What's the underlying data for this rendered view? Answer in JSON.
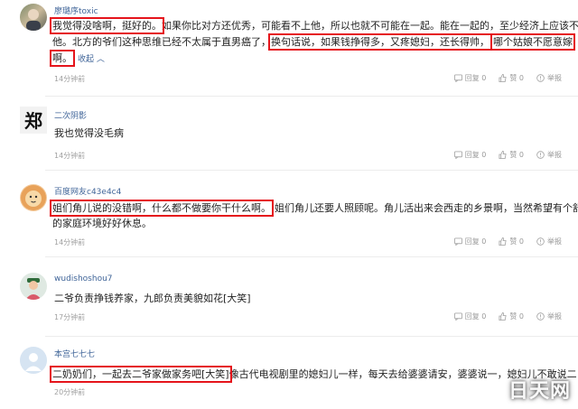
{
  "comments": [
    {
      "username": "廖璐序toxic",
      "avatar": "photo-avatar",
      "text_lines": [
        [
          "我觉得没啥啊，挺好的。",
          "如果你比对方还优秀，可能看不上他，所以也就不可能在一起。能在一起的，至少经济上应该不如"
        ],
        [
          "他。北方的爷们这种思维已经不太属于直男癌了，",
          "换句话说，如果钱挣得多，又疼媳妇，还长得帅，",
          "哪个姑娘不愿意嫁"
        ],
        [
          "啊。",
          "收起"
        ]
      ],
      "time": "14分钟前",
      "reply_label": "回复 0",
      "like_label": "赞 0",
      "report_label": "举报"
    },
    {
      "username": "二次阴影",
      "avatar": "calligraphy-avatar",
      "avatar_text": "郑",
      "text": "我也觉得没毛病",
      "time": "14分钟前",
      "reply_label": "回复 0",
      "like_label": "赞 0",
      "report_label": "举报"
    },
    {
      "username": "百度网友c43e4c4",
      "avatar": "lion-avatar",
      "text_lines": [
        [
          "姐们角儿说的没错啊，什么都不做要你干什么啊。",
          "姐们角儿还要人照顾呢。角儿活出来会西走的乡景啊，当然希望有个舒适"
        ],
        [
          "的家庭环境好好休息。"
        ]
      ],
      "time": "14分钟前",
      "reply_label": "回复 0",
      "like_label": "赞 0",
      "report_label": "举报"
    },
    {
      "username": "wudishoshou7",
      "avatar": "person-avatar",
      "text": "二爷负责挣钱养家，九郎负责美貌如花[大笑]",
      "time": "17分钟前",
      "reply_label": "回复 0",
      "like_label": "赞 0",
      "report_label": "举报"
    },
    {
      "username": "本宫七七七",
      "avatar": "default-avatar",
      "text_lines": [
        [
          "二奶奶们，一起去二爷家做家务吧[大笑]",
          "像古代电视剧里的媳妇儿一样，每天去给婆婆请安，婆婆说一，媳妇儿不敢说二"
        ]
      ],
      "time": "20分钟前",
      "reply_label": "回复 0",
      "like_label": "赞 0",
      "report_label": "举报"
    }
  ],
  "watermark": "日天网",
  "colors": {
    "highlight": "#e5141b",
    "username": "#406599",
    "meta": "#a0a0a0"
  }
}
